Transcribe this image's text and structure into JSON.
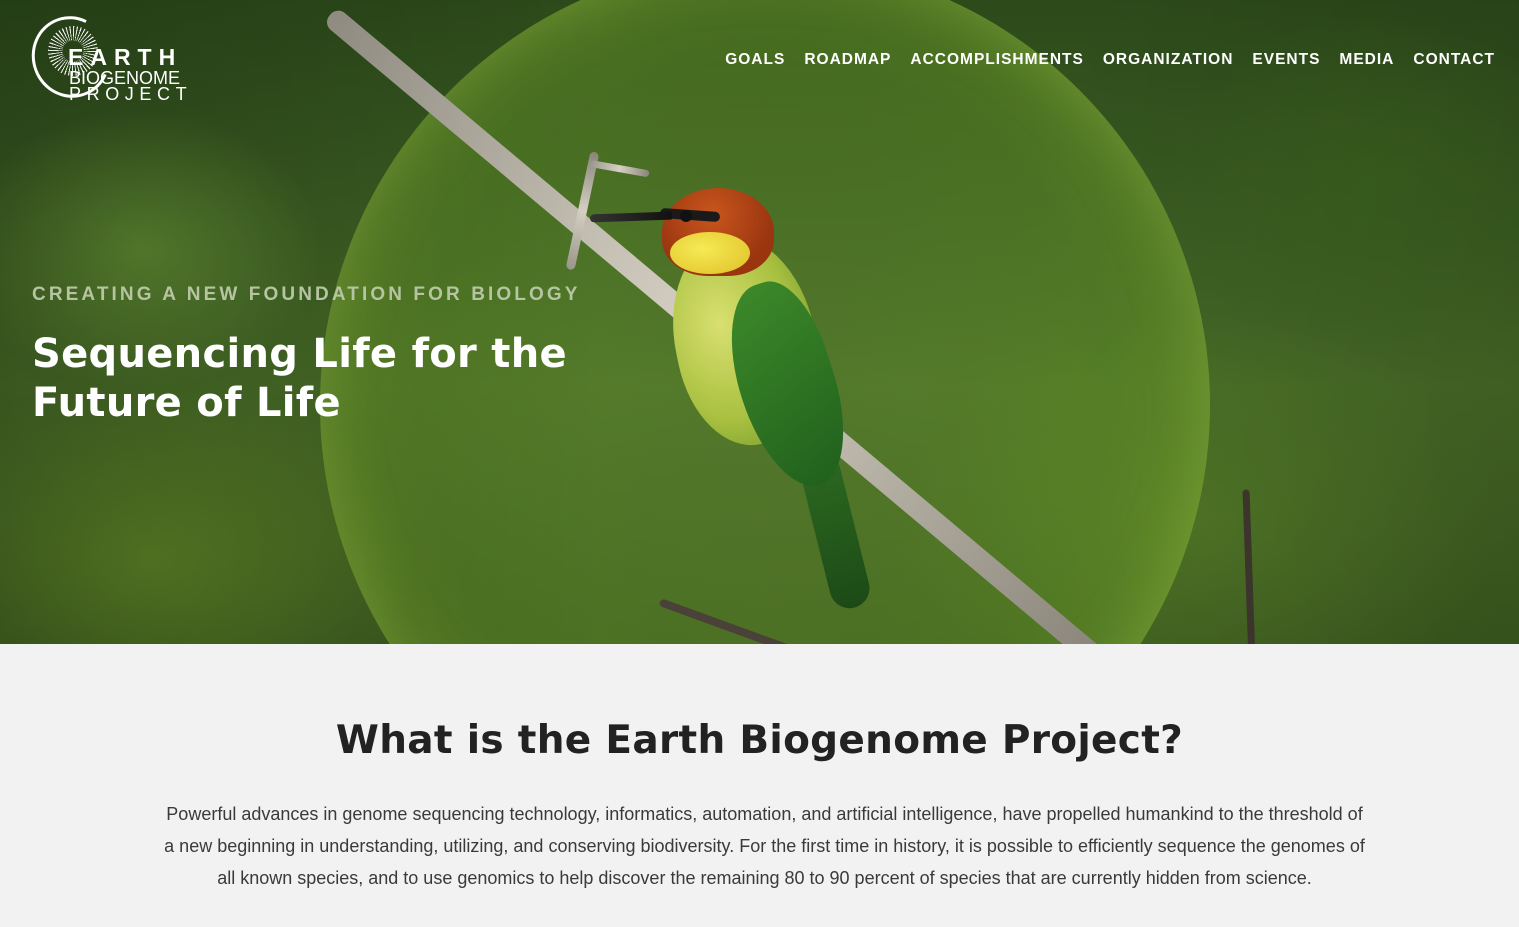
{
  "logo": {
    "line1": "EARTH",
    "line2": "BIOGENOME",
    "line3": "PROJECT"
  },
  "nav": {
    "items": [
      {
        "label": "GOALS"
      },
      {
        "label": "ROADMAP"
      },
      {
        "label": "ACCOMPLISHMENTS"
      },
      {
        "label": "ORGANIZATION"
      },
      {
        "label": "EVENTS"
      },
      {
        "label": "MEDIA"
      },
      {
        "label": "CONTACT"
      }
    ]
  },
  "hero": {
    "eyebrow": "CREATING A NEW FOUNDATION FOR BIOLOGY",
    "title": "Sequencing Life for the Future of Life"
  },
  "intro": {
    "title": "What is the Earth Biogenome Project?",
    "body": "Powerful advances in genome sequencing technology, informatics, automation, and artificial intelligence, have propelled humankind to the threshold of a new beginning in understanding, utilizing, and conserving biodiversity. For the first time in history, it is possible to efficiently sequence the genomes of all known species, and to use genomics to help discover the remaining 80 to 90 percent of species that are currently hidden from science."
  },
  "colors": {
    "hero_eyebrow": "#b6c4a1",
    "nav_text": "#ffffff",
    "page_background": "#f2f2f2",
    "heading_text": "#222222"
  }
}
